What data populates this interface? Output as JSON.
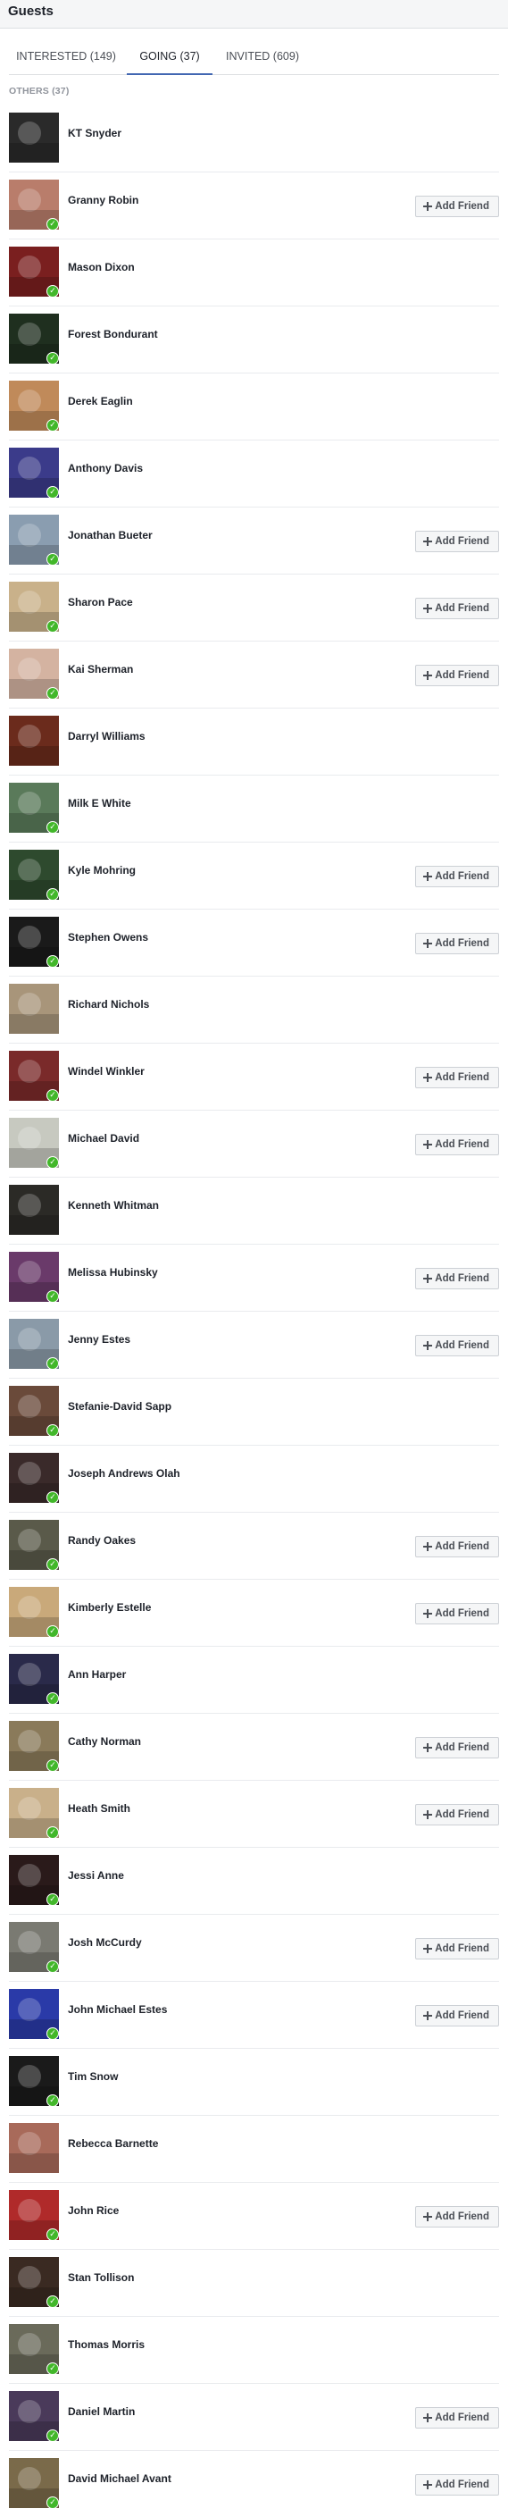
{
  "header": {
    "title": "Guests"
  },
  "tabs": [
    {
      "label": "INTERESTED (149)",
      "active": false
    },
    {
      "label": "GOING (37)",
      "active": true
    },
    {
      "label": "INVITED (609)",
      "active": false
    }
  ],
  "section_label": "OTHERS (37)",
  "add_friend_label": "Add Friend",
  "colors": {
    "accent": "#4267b2",
    "going_check": "#42b72a"
  },
  "guests": [
    {
      "name": "KT Snyder",
      "add_friend": false,
      "going": false,
      "avatar_color": "#2a2a2a"
    },
    {
      "name": "Granny Robin",
      "add_friend": true,
      "going": true,
      "avatar_color": "#b97d6b"
    },
    {
      "name": "Mason Dixon",
      "add_friend": false,
      "going": true,
      "avatar_color": "#7a1f1f"
    },
    {
      "name": "Forest Bondurant",
      "add_friend": false,
      "going": true,
      "avatar_color": "#1f2f1f"
    },
    {
      "name": "Derek Eaglin",
      "add_friend": false,
      "going": true,
      "avatar_color": "#c08a5a"
    },
    {
      "name": "Anthony Davis",
      "add_friend": false,
      "going": true,
      "avatar_color": "#3b3b8a"
    },
    {
      "name": "Jonathan Bueter",
      "add_friend": true,
      "going": true,
      "avatar_color": "#8a9db0"
    },
    {
      "name": "Sharon Pace",
      "add_friend": true,
      "going": true,
      "avatar_color": "#c9b18a"
    },
    {
      "name": "Kai Sherman",
      "add_friend": true,
      "going": true,
      "avatar_color": "#d4b3a1"
    },
    {
      "name": "Darryl Williams",
      "add_friend": false,
      "going": false,
      "avatar_color": "#6b2b1c"
    },
    {
      "name": "Milk E White",
      "add_friend": false,
      "going": true,
      "avatar_color": "#5a7a5a"
    },
    {
      "name": "Kyle Mohring",
      "add_friend": true,
      "going": true,
      "avatar_color": "#2e4a2e"
    },
    {
      "name": "Stephen Owens",
      "add_friend": true,
      "going": true,
      "avatar_color": "#1a1a1a"
    },
    {
      "name": "Richard Nichols",
      "add_friend": false,
      "going": false,
      "avatar_color": "#a8957a"
    },
    {
      "name": "Windel Winkler",
      "add_friend": true,
      "going": true,
      "avatar_color": "#7a2a2a"
    },
    {
      "name": "Michael David",
      "add_friend": true,
      "going": true,
      "avatar_color": "#c7c9c0"
    },
    {
      "name": "Kenneth Whitman",
      "add_friend": false,
      "going": false,
      "avatar_color": "#2b2a26"
    },
    {
      "name": "Melissa Hubinsky",
      "add_friend": true,
      "going": true,
      "avatar_color": "#6a3a6a"
    },
    {
      "name": "Jenny Estes",
      "add_friend": true,
      "going": true,
      "avatar_color": "#8a9aa8"
    },
    {
      "name": "Stefanie-David Sapp",
      "add_friend": false,
      "going": true,
      "avatar_color": "#6a4a3a"
    },
    {
      "name": "Joseph Andrews Olah",
      "add_friend": false,
      "going": true,
      "avatar_color": "#3a2a2a"
    },
    {
      "name": "Randy Oakes",
      "add_friend": true,
      "going": true,
      "avatar_color": "#5a5a4a"
    },
    {
      "name": "Kimberly Estelle",
      "add_friend": true,
      "going": true,
      "avatar_color": "#c9a97a"
    },
    {
      "name": "Ann Harper",
      "add_friend": false,
      "going": true,
      "avatar_color": "#2a2a4a"
    },
    {
      "name": "Cathy Norman",
      "add_friend": true,
      "going": true,
      "avatar_color": "#8a7a5a"
    },
    {
      "name": "Heath Smith",
      "add_friend": true,
      "going": true,
      "avatar_color": "#c9b08a"
    },
    {
      "name": "Jessi Anne",
      "add_friend": false,
      "going": true,
      "avatar_color": "#2a1a1a"
    },
    {
      "name": "Josh McCurdy",
      "add_friend": true,
      "going": true,
      "avatar_color": "#7a7a72"
    },
    {
      "name": "John Michael Estes",
      "add_friend": true,
      "going": true,
      "avatar_color": "#2a3aa8"
    },
    {
      "name": "Tim Snow",
      "add_friend": false,
      "going": true,
      "avatar_color": "#1a1a1a"
    },
    {
      "name": "Rebecca Barnette",
      "add_friend": false,
      "going": false,
      "avatar_color": "#a86a5a"
    },
    {
      "name": "John Rice",
      "add_friend": true,
      "going": true,
      "avatar_color": "#b02a2a"
    },
    {
      "name": "Stan Tollison",
      "add_friend": false,
      "going": true,
      "avatar_color": "#3a2a22"
    },
    {
      "name": "Thomas Morris",
      "add_friend": false,
      "going": true,
      "avatar_color": "#6a6a5a"
    },
    {
      "name": "Daniel Martin",
      "add_friend": true,
      "going": true,
      "avatar_color": "#4a3a5a"
    },
    {
      "name": "David Michael Avant",
      "add_friend": true,
      "going": true,
      "avatar_color": "#7a6a4a"
    }
  ]
}
